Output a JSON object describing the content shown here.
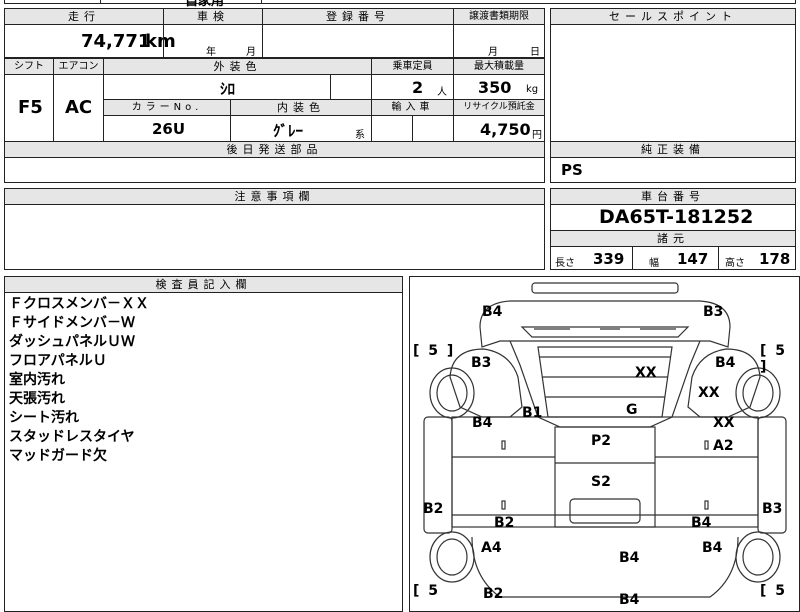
{
  "top_partial": {
    "text_left": "自家用",
    "text_right": "8"
  },
  "mileage": {
    "label": "走行",
    "value": "74,771",
    "unit": "km"
  },
  "inspection": {
    "label": "車検",
    "year_unit": "年",
    "month_unit": "月"
  },
  "registration": {
    "label": "登録番号"
  },
  "transfer": {
    "label": "譲渡書類期限",
    "month_unit": "月",
    "day_unit": "日"
  },
  "sales_point": {
    "label": "セールスポイント"
  },
  "shift": {
    "label": "シフト",
    "value": "F5"
  },
  "aircon": {
    "label": "エアコン",
    "value": "AC"
  },
  "exterior_color": {
    "label": "外装色",
    "value": "ｼﾛ"
  },
  "capacity": {
    "label": "乗車定員",
    "value": "2",
    "unit": "人"
  },
  "max_load": {
    "label": "最大積載量",
    "value": "350",
    "unit": "kg"
  },
  "color_no": {
    "label": "カラーNo.",
    "value": "26U"
  },
  "interior_color": {
    "label": "内装色",
    "value": "ｸﾞﾚｰ",
    "suffix": "系"
  },
  "import": {
    "label": "輸入車"
  },
  "recycle": {
    "label": "リサイクル預託金",
    "value": "4,750",
    "unit": "円"
  },
  "later_parts": {
    "label": "後日発送部品"
  },
  "genuine_equipment": {
    "label": "純正装備",
    "value": "PS"
  },
  "notes": {
    "label": "注意事項欄"
  },
  "chassis": {
    "label": "車台番号",
    "value": "DA65T-181252"
  },
  "specs": {
    "label": "諸元",
    "length_label": "長さ",
    "length": "339",
    "width_label": "幅",
    "width": "147",
    "height_label": "高さ",
    "height": "178"
  },
  "inspector": {
    "label": "検査員記入欄",
    "items": [
      "Ｆクロスメンバ－ＸＸ",
      "Ｆサイドメンバ－Ｗ",
      "ダッシュパネルＵＷ",
      "フロアパネルＵ",
      "室内汚れ",
      "天張汚れ",
      "シート汚れ",
      "スタッドレスタイヤ",
      "マッドガード欠"
    ]
  },
  "diagram": {
    "brackets": [
      "[ 5 ]",
      "[ 5 ]",
      "[ 5",
      "[ 5"
    ],
    "labels": [
      "B4",
      "B3",
      "B3",
      "B4",
      "XX",
      "XX",
      "B1",
      "G",
      "B4",
      "XX",
      "A2",
      "P2",
      "S2",
      "B2",
      "B3",
      "B2",
      "B4",
      "A4",
      "B4",
      "B4",
      "B2",
      "B4"
    ]
  }
}
